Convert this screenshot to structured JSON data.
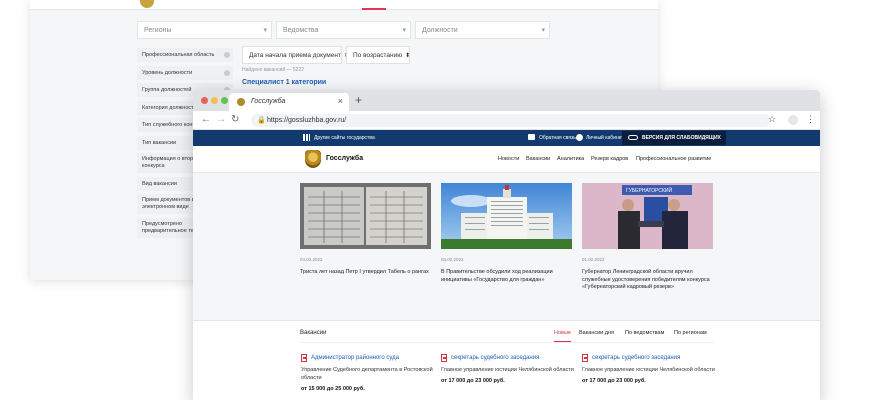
{
  "back_window": {
    "filters": {
      "regions": "Регионы",
      "departments": "Ведомства",
      "positions": "Должности"
    },
    "sort": {
      "date_button": "Дата начала приема документ",
      "order_button": "По возрастанию"
    },
    "found_text": "Найдено вакансий — 5222",
    "vacancy_link": "Специалист 1 категории",
    "sidebar": [
      "Профессиональная область",
      "Уровень должности",
      "Группа должностей",
      "Категория должности",
      "Тип служебного контракта",
      "Тип вакансии",
      "Информация о втором этапе конкурса",
      "Вид вакансии",
      "Прием документов в электронном виде",
      "Предусмотрено предварительное тестирование"
    ]
  },
  "browser": {
    "tab_title": "Госслужба",
    "new_tab": "+",
    "close_tab": "×",
    "url": "https://gossluzhba.gov.ru/"
  },
  "site": {
    "top_strip": {
      "other_sites": "Другие сайты государства",
      "feedback": "Обратная связь",
      "cabinet": "Личный кабинет",
      "impaired_version": "ВЕРСИЯ ДЛЯ СЛАБОВИДЯЩИХ"
    },
    "brand": "Госслужба",
    "nav": [
      "Новости",
      "Вакансии",
      "Аналитика",
      "Резерв кадров",
      "Профессиональное развитие"
    ],
    "news": [
      {
        "date": "04.02.2022",
        "title": "Триста лет назад Петр I утвердил Табель о рангах"
      },
      {
        "date": "03.02.2022",
        "title": "В Правительстве обсудили ход реализации инициативы «Государство для граждан»"
      },
      {
        "date": "01.02.2022",
        "title": "Губернатор Ленинградской области вручил служебные удостоверения победителям конкурса «Губернаторский кадровый резерв»",
        "image_caption": "ГУБЕРНАТОРСКИЙ"
      }
    ],
    "vacancies": {
      "heading": "Вакансии",
      "tabs": [
        "Новые",
        "Вакансии дня",
        "По ведомствам",
        "По регионам"
      ],
      "active_tab": "Новые",
      "cards": [
        {
          "title": "Администратор районного суда",
          "org": "Управление Судебного департамента в Ростовской области",
          "salary": "от 15 000 до 25 000 руб."
        },
        {
          "title": "секретарь судебного заседания",
          "org": "Главное управление юстиции Челябинской области",
          "salary": "от 17 000 до 23 000 руб."
        },
        {
          "title": "секретарь судебного заседания",
          "org": "Главное управление юстиции Челябинской области",
          "salary": "от 17 000 до 23 000 руб."
        }
      ]
    }
  }
}
